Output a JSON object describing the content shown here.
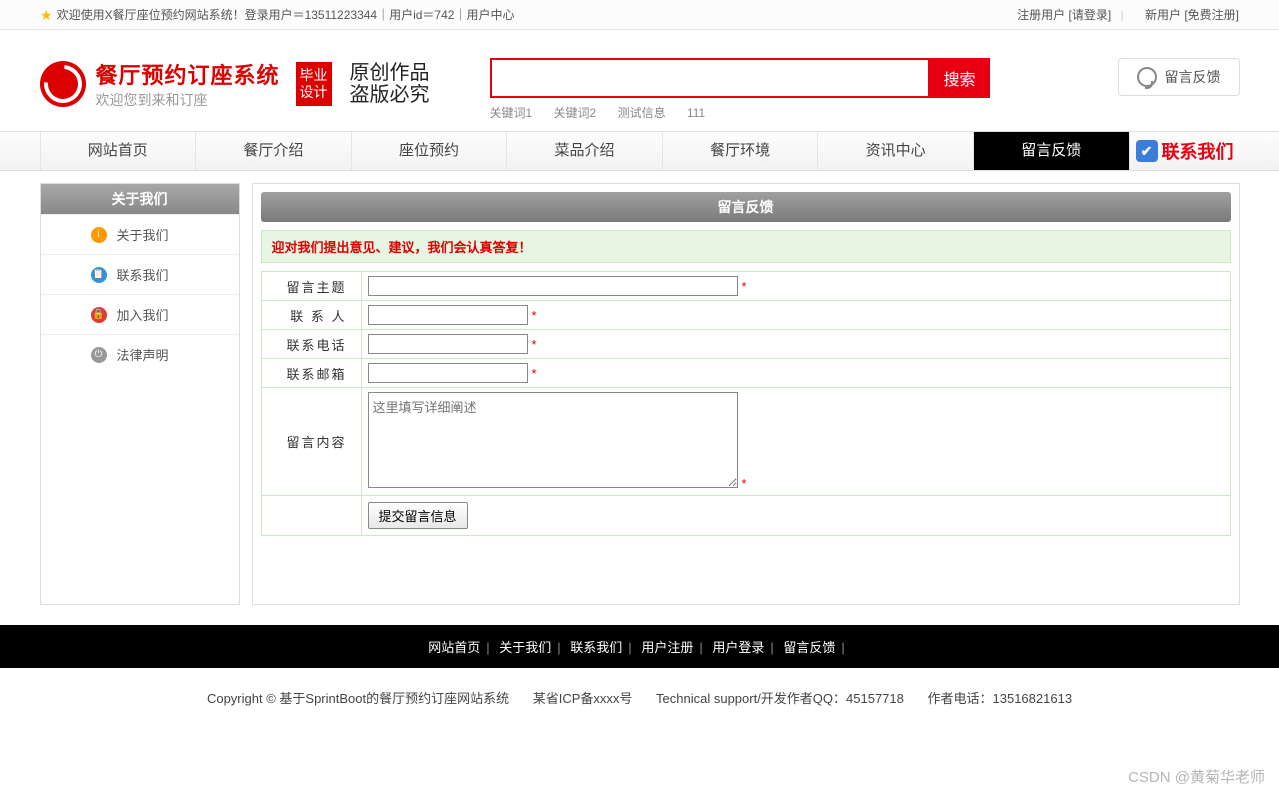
{
  "topbar": {
    "welcome": "欢迎使用X餐厅座位预约网站系统！登录用户＝13511223344｜用户id＝742｜用户中心",
    "registered_label": "注册用户",
    "login_link": "[请登录]",
    "new_user_label": "新用户",
    "register_link": "[免费注册]"
  },
  "header": {
    "title": "餐厅预约订座系统",
    "subtitle": "欢迎您到来和订座",
    "badge": "毕业设计",
    "calligraphy_line1": "原创作品",
    "calligraphy_line2": "盗版必究"
  },
  "search": {
    "button": "搜索",
    "keywords": [
      "关键词1",
      "关键词2",
      "测试信息",
      "111"
    ]
  },
  "feedback_button": "留言反馈",
  "nav": {
    "items": [
      "网站首页",
      "餐厅介绍",
      "座位预约",
      "菜品介绍",
      "餐厅环境",
      "资讯中心",
      "留言反馈"
    ],
    "contact": "联系我们",
    "active_index": 6
  },
  "sidebar": {
    "head": "关于我们",
    "items": [
      {
        "label": "关于我们",
        "color": "orange"
      },
      {
        "label": "联系我们",
        "color": "blue"
      },
      {
        "label": "加入我们",
        "color": "red"
      },
      {
        "label": "法律声明",
        "color": "gray"
      }
    ]
  },
  "main": {
    "head": "留言反馈",
    "notice": "迎对我们提出意见、建议，我们会认真答复！",
    "fields": {
      "subject": "留言主题",
      "contact": "联 系 人",
      "phone": "联系电话",
      "email": "联系邮箱",
      "content": "留言内容",
      "placeholder_content": "这里填写详细阐述"
    },
    "submit": "提交留言信息"
  },
  "footer_nav": [
    "网站首页",
    "关于我们",
    "联系我们",
    "用户注册",
    "用户登录",
    "留言反馈"
  ],
  "footer_info": {
    "copyright": "Copyright © 基于SprintBoot的餐厅预约订座网站系统",
    "icp": "某省ICP备xxxx号",
    "tech": "Technical support/开发作者QQ：45157718",
    "author_phone": "作者电话：13516821613"
  },
  "watermark": "CSDN @黄菊华老师"
}
